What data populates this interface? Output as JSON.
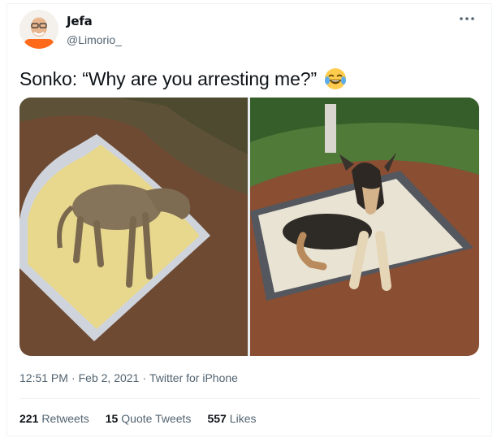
{
  "author": {
    "name": "Jefa",
    "handle": "@Limorio_"
  },
  "tweet": {
    "text": "Sonko: “Why are you arresting me?”",
    "emoji": "face-with-tears-of-joy"
  },
  "meta": {
    "time": "12:51 PM",
    "separator": "·",
    "date": "Feb 2, 2021",
    "source": "Twitter for iPhone"
  },
  "stats": [
    {
      "count": "221",
      "label": "Retweets"
    },
    {
      "count": "15",
      "label": "Quote Tweets"
    },
    {
      "count": "557",
      "label": "Likes"
    }
  ],
  "icons": {
    "more": "more-horizontal-icon"
  },
  "colors": {
    "secondary_text": "#536471",
    "primary_text": "#0f1419",
    "divider": "#eff3f4"
  }
}
